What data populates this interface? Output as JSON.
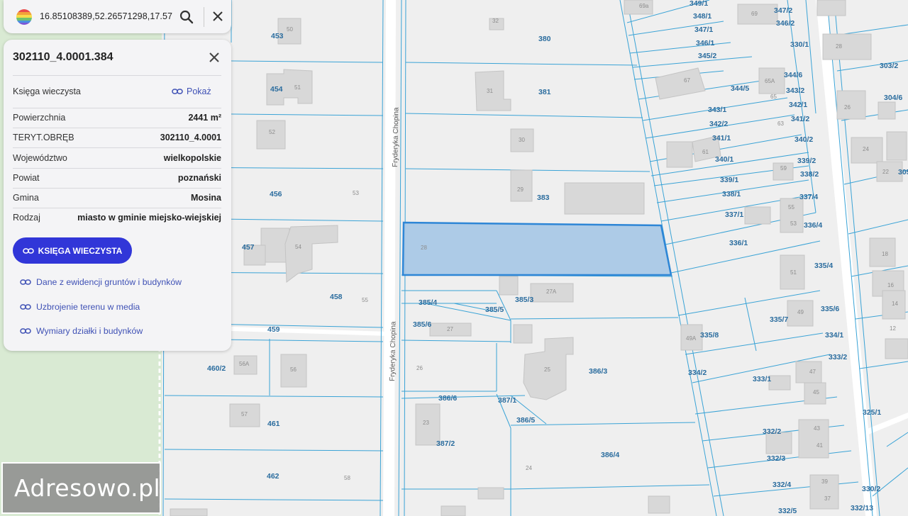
{
  "search": {
    "value": "16.85108389,52.26571298,17.57"
  },
  "panel": {
    "title": "302110_4.0001.384",
    "kw_label": "Księga wieczysta",
    "pokaz": "Pokaż",
    "rows": [
      {
        "label": "Powierzchnia",
        "value": "2441 m²"
      },
      {
        "label": "TERYT.OBRĘB",
        "value": "302110_4.0001"
      },
      {
        "label": "Województwo",
        "value": "wielkopolskie"
      },
      {
        "label": "Powiat",
        "value": "poznański"
      },
      {
        "label": "Gmina",
        "value": "Mosina"
      },
      {
        "label": "Rodzaj",
        "value": "miasto w gminie miejsko-wiejskiej"
      }
    ],
    "button": "KSIĘGA WIECZYSTA",
    "links": [
      "Dane z ewidencji gruntów i budynków",
      "Uzbrojenie terenu w media",
      "Wymiary działki i budynków"
    ]
  },
  "map": {
    "street": "Fryderyka Chopina",
    "selected_plot_building": "28",
    "plot_labels": [
      "453",
      "454",
      "456",
      "457",
      "458",
      "459",
      "460/2",
      "461",
      "462",
      "380",
      "381",
      "383",
      "385/3",
      "385/4",
      "385/5",
      "385/6",
      "386/3",
      "386/4",
      "386/5",
      "386/6",
      "387/1",
      "387/2",
      "349/1",
      "348/1",
      "347/1",
      "346/1",
      "345/2",
      "344/5",
      "344/6",
      "343/1",
      "343/2",
      "342/1",
      "342/2",
      "341/1",
      "341/2",
      "340/1",
      "340/2",
      "339/1",
      "339/2",
      "338/1",
      "338/2",
      "337/1",
      "337/4",
      "336/1",
      "336/4",
      "335/4",
      "335/6",
      "335/7",
      "335/8",
      "334/1",
      "334/2",
      "333/1",
      "333/2",
      "332/2",
      "332/3",
      "332/4",
      "332/5",
      "332/13",
      "330/1",
      "330/2",
      "325/1",
      "303/2",
      "304/6",
      "347/2",
      "346/2",
      "305"
    ],
    "building_labels": [
      "50",
      "51",
      "52",
      "53",
      "54",
      "55",
      "56",
      "56A",
      "57",
      "58",
      "32",
      "31",
      "30",
      "29",
      "27",
      "27A",
      "26",
      "25",
      "24",
      "23",
      "69a",
      "69",
      "67",
      "65A",
      "65",
      "63",
      "61",
      "59",
      "55",
      "53",
      "51",
      "49",
      "49A",
      "47",
      "45",
      "43",
      "41",
      "39",
      "37",
      "28",
      "26",
      "24",
      "22",
      "18",
      "16",
      "14",
      "12"
    ]
  },
  "watermark": "Adresowo.pl"
}
